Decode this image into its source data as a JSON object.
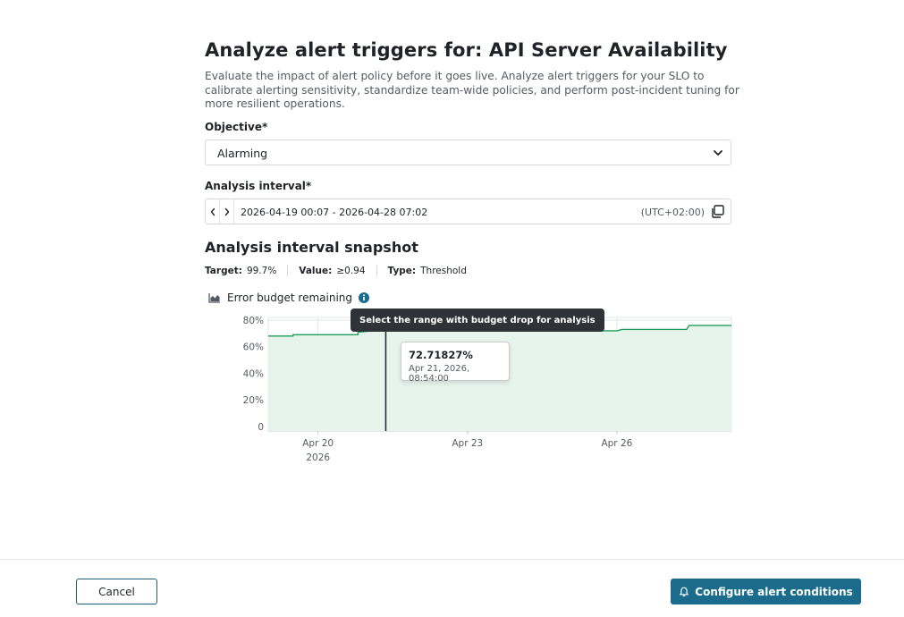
{
  "header": {
    "title": "Analyze alert triggers for: API Server Availability",
    "description": "Evaluate the impact of alert policy before it goes live. Analyze alert triggers for your SLO to calibrate alerting sensitivity, standardize team-wide policies, and perform post-incident tuning for more resilient operations."
  },
  "objective": {
    "label": "Objective",
    "required_mark": "*",
    "selected": "Alarming",
    "icon": "chevron-down-icon"
  },
  "interval": {
    "label": "Analysis interval",
    "required_mark": "*",
    "range": "2026-04-19 00:07 - 2026-04-28 07:02",
    "timezone": "(UTC+02:00)",
    "icons": [
      "chevron-left-icon",
      "chevron-right-icon",
      "copy-icon"
    ]
  },
  "snapshot": {
    "title": "Analysis interval snapshot",
    "target_label": "Target:",
    "target_value": "99.7%",
    "value_label": "Value:",
    "value_value": "≥0.94",
    "type_label": "Type:",
    "type_value": "Threshold"
  },
  "chart_panel": {
    "title": "Error budget remaining",
    "tooltip_hint": "Select the range with budget drop for analysis",
    "hover_value": "72.71827%",
    "hover_date": "Apr 21, 2026, 08:54:00"
  },
  "chart_data": {
    "type": "area",
    "title": "Error budget remaining",
    "y_ticks": [
      "0",
      "20%",
      "40%",
      "60%",
      "80%"
    ],
    "x_ticks": [
      {
        "label": "Apr 20",
        "sub": "2026",
        "day": 20
      },
      {
        "label": "Apr 23",
        "sub": "",
        "day": 23
      },
      {
        "label": "Apr 26",
        "sub": "",
        "day": 26
      }
    ],
    "ylim": [
      0,
      82
    ],
    "xlim_days": [
      19.0,
      28.3
    ],
    "grid": true,
    "color_line": "#1e9e5a",
    "color_fill": "#e6f4ec",
    "series": [
      {
        "points": [
          {
            "day": 19.0,
            "value": 68
          },
          {
            "day": 19.5,
            "value": 68
          },
          {
            "day": 19.5,
            "value": 69
          },
          {
            "day": 20.8,
            "value": 69
          },
          {
            "day": 20.8,
            "value": 71
          },
          {
            "day": 21.36,
            "value": 72.7
          },
          {
            "day": 22.5,
            "value": 72
          },
          {
            "day": 23.5,
            "value": 72
          },
          {
            "day": 25.3,
            "value": 72
          },
          {
            "day": 26.0,
            "value": 72
          },
          {
            "day": 26.1,
            "value": 73
          },
          {
            "day": 27.4,
            "value": 73
          },
          {
            "day": 27.45,
            "value": 76
          },
          {
            "day": 28.3,
            "value": 76
          }
        ]
      }
    ],
    "hover_day": 21.36
  },
  "footer": {
    "cancel_label": "Cancel",
    "primary_label": "Configure alert conditions",
    "primary_icon": "bell-icon"
  }
}
